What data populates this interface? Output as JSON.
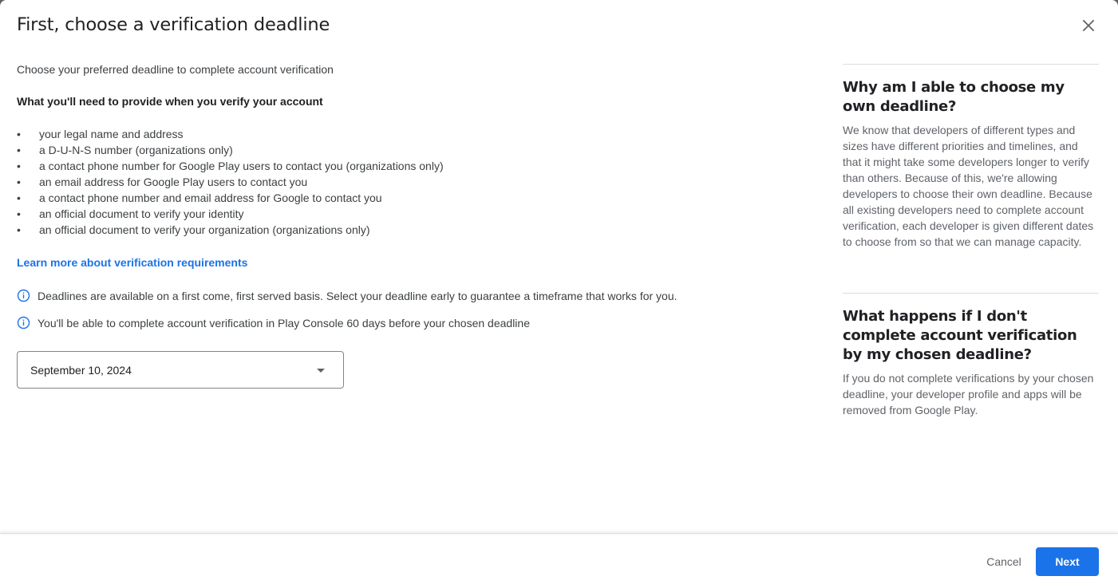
{
  "dialog": {
    "title": "First, choose a verification deadline",
    "close_icon": "close-icon"
  },
  "main": {
    "intro": "Choose your preferred deadline to complete account verification",
    "requirements_heading": "What you'll need to provide when you verify your account",
    "bullet_char": "•",
    "requirements": [
      "your legal name and address",
      "a D-U-N-S number (organizations only)",
      "a contact phone number for Google Play users to contact you (organizations only)",
      "an email address for Google Play users to contact you",
      "a contact phone number and email address for Google to contact you",
      "an official document to verify your identity",
      "an official document to verify your organization (organizations only)"
    ],
    "learn_more_link": "Learn more about verification requirements",
    "info_notes": [
      "Deadlines are available on a first come, first served basis. Select your deadline early to guarantee a timeframe that works for you.",
      "You'll be able to complete account verification in Play Console 60 days before your chosen deadline"
    ],
    "deadline_select": {
      "selected_value": "September 10, 2024"
    }
  },
  "sidebar": {
    "sections": [
      {
        "question": "Why am I able to choose my own deadline?",
        "answer": "We know that developers of different types and sizes have different priorities and timelines, and that it might take some developers longer to verify than others. Because of this, we're allowing developers to choose their own deadline. Because all existing developers need to complete account verification, each developer is given different dates to choose from so that we can manage capacity."
      },
      {
        "question": "What happens if I don't complete account verification by my chosen deadline?",
        "answer": "If you do not complete verifications by your chosen deadline, your developer profile and apps will be removed from Google Play."
      }
    ]
  },
  "footer": {
    "cancel_label": "Cancel",
    "next_label": "Next"
  },
  "colors": {
    "accent": "#1a73e8",
    "text_primary": "#202124",
    "text_secondary": "#5f6368"
  }
}
